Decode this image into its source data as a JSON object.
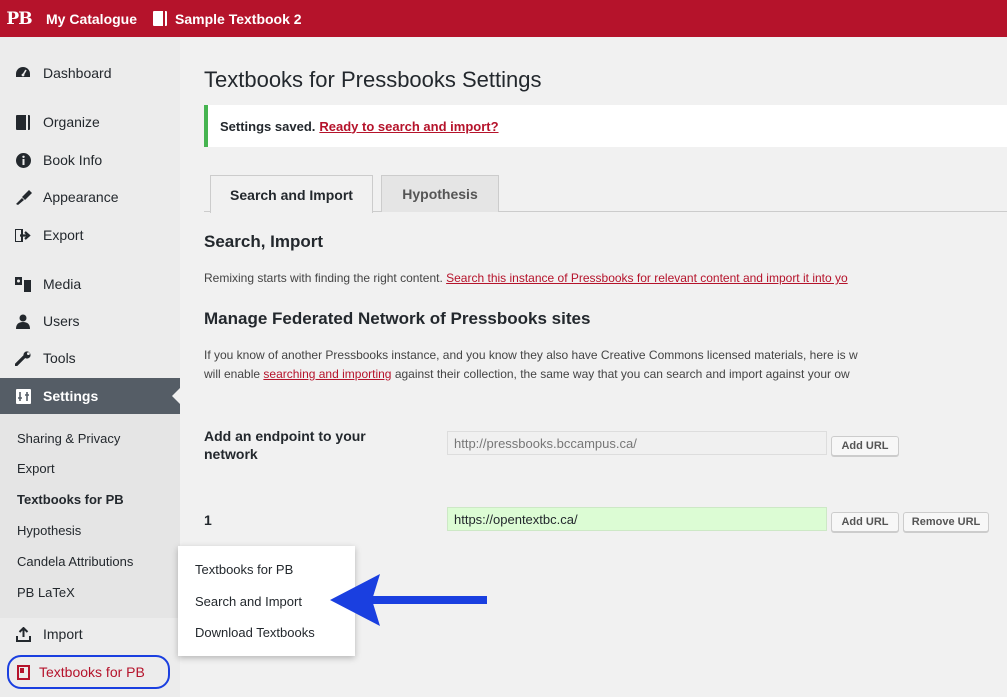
{
  "adminbar": {
    "logo": "PB",
    "catalogue": "My Catalogue",
    "book": "Sample Textbook 2"
  },
  "sidebar": {
    "items": [
      {
        "label": "Dashboard",
        "icon": "dashboard-icon"
      },
      {
        "label": "Organize",
        "icon": "book-icon"
      },
      {
        "label": "Book Info",
        "icon": "info-icon"
      },
      {
        "label": "Appearance",
        "icon": "brush-icon"
      },
      {
        "label": "Export",
        "icon": "export-icon"
      },
      {
        "label": "Media",
        "icon": "media-icon"
      },
      {
        "label": "Users",
        "icon": "users-icon"
      },
      {
        "label": "Tools",
        "icon": "wrench-icon"
      },
      {
        "label": "Settings",
        "icon": "settings-icon"
      }
    ],
    "submenu": [
      "Sharing & Privacy",
      "Export",
      "Textbooks for PB",
      "Hypothesis",
      "Candela Attributions",
      "PB LaTeX"
    ],
    "import": "Import",
    "textbooks_for_pb": "Textbooks for PB"
  },
  "main": {
    "title": "Textbooks for Pressbooks Settings",
    "notice_text": "Settings saved.",
    "notice_link": "Ready to search and import?",
    "tabs": [
      "Search and Import",
      "Hypothesis"
    ],
    "section1_heading": "Search, Import",
    "section1_text": "Remixing starts with finding the right content.",
    "section1_link": "Search this instance of Pressbooks for relevant content and import it into yo",
    "section2_heading": "Manage Federated Network of Pressbooks sites",
    "section2_line1": "If you know of another Pressbooks instance, and you know they also have Creative Commons licensed materials, here is w",
    "section2_line2_pre": "will enable",
    "section2_link": "searching and importing",
    "section2_line2_post": "against their collection, the same way that you can search and import against your ow",
    "endpoint_label": "Add an endpoint to your network",
    "endpoint_placeholder": "http://pressbooks.bccampus.ca/",
    "add_url": "Add URL",
    "row1_index": "1",
    "row1_value": "https://opentextbc.ca/",
    "remove_url": "Remove URL"
  },
  "flyout": {
    "items": [
      "Textbooks for PB",
      "Search and Import",
      "Download Textbooks"
    ]
  },
  "colors": {
    "brand": "#b5132b",
    "annotation": "#1a3fe0",
    "success": "#46b450"
  }
}
